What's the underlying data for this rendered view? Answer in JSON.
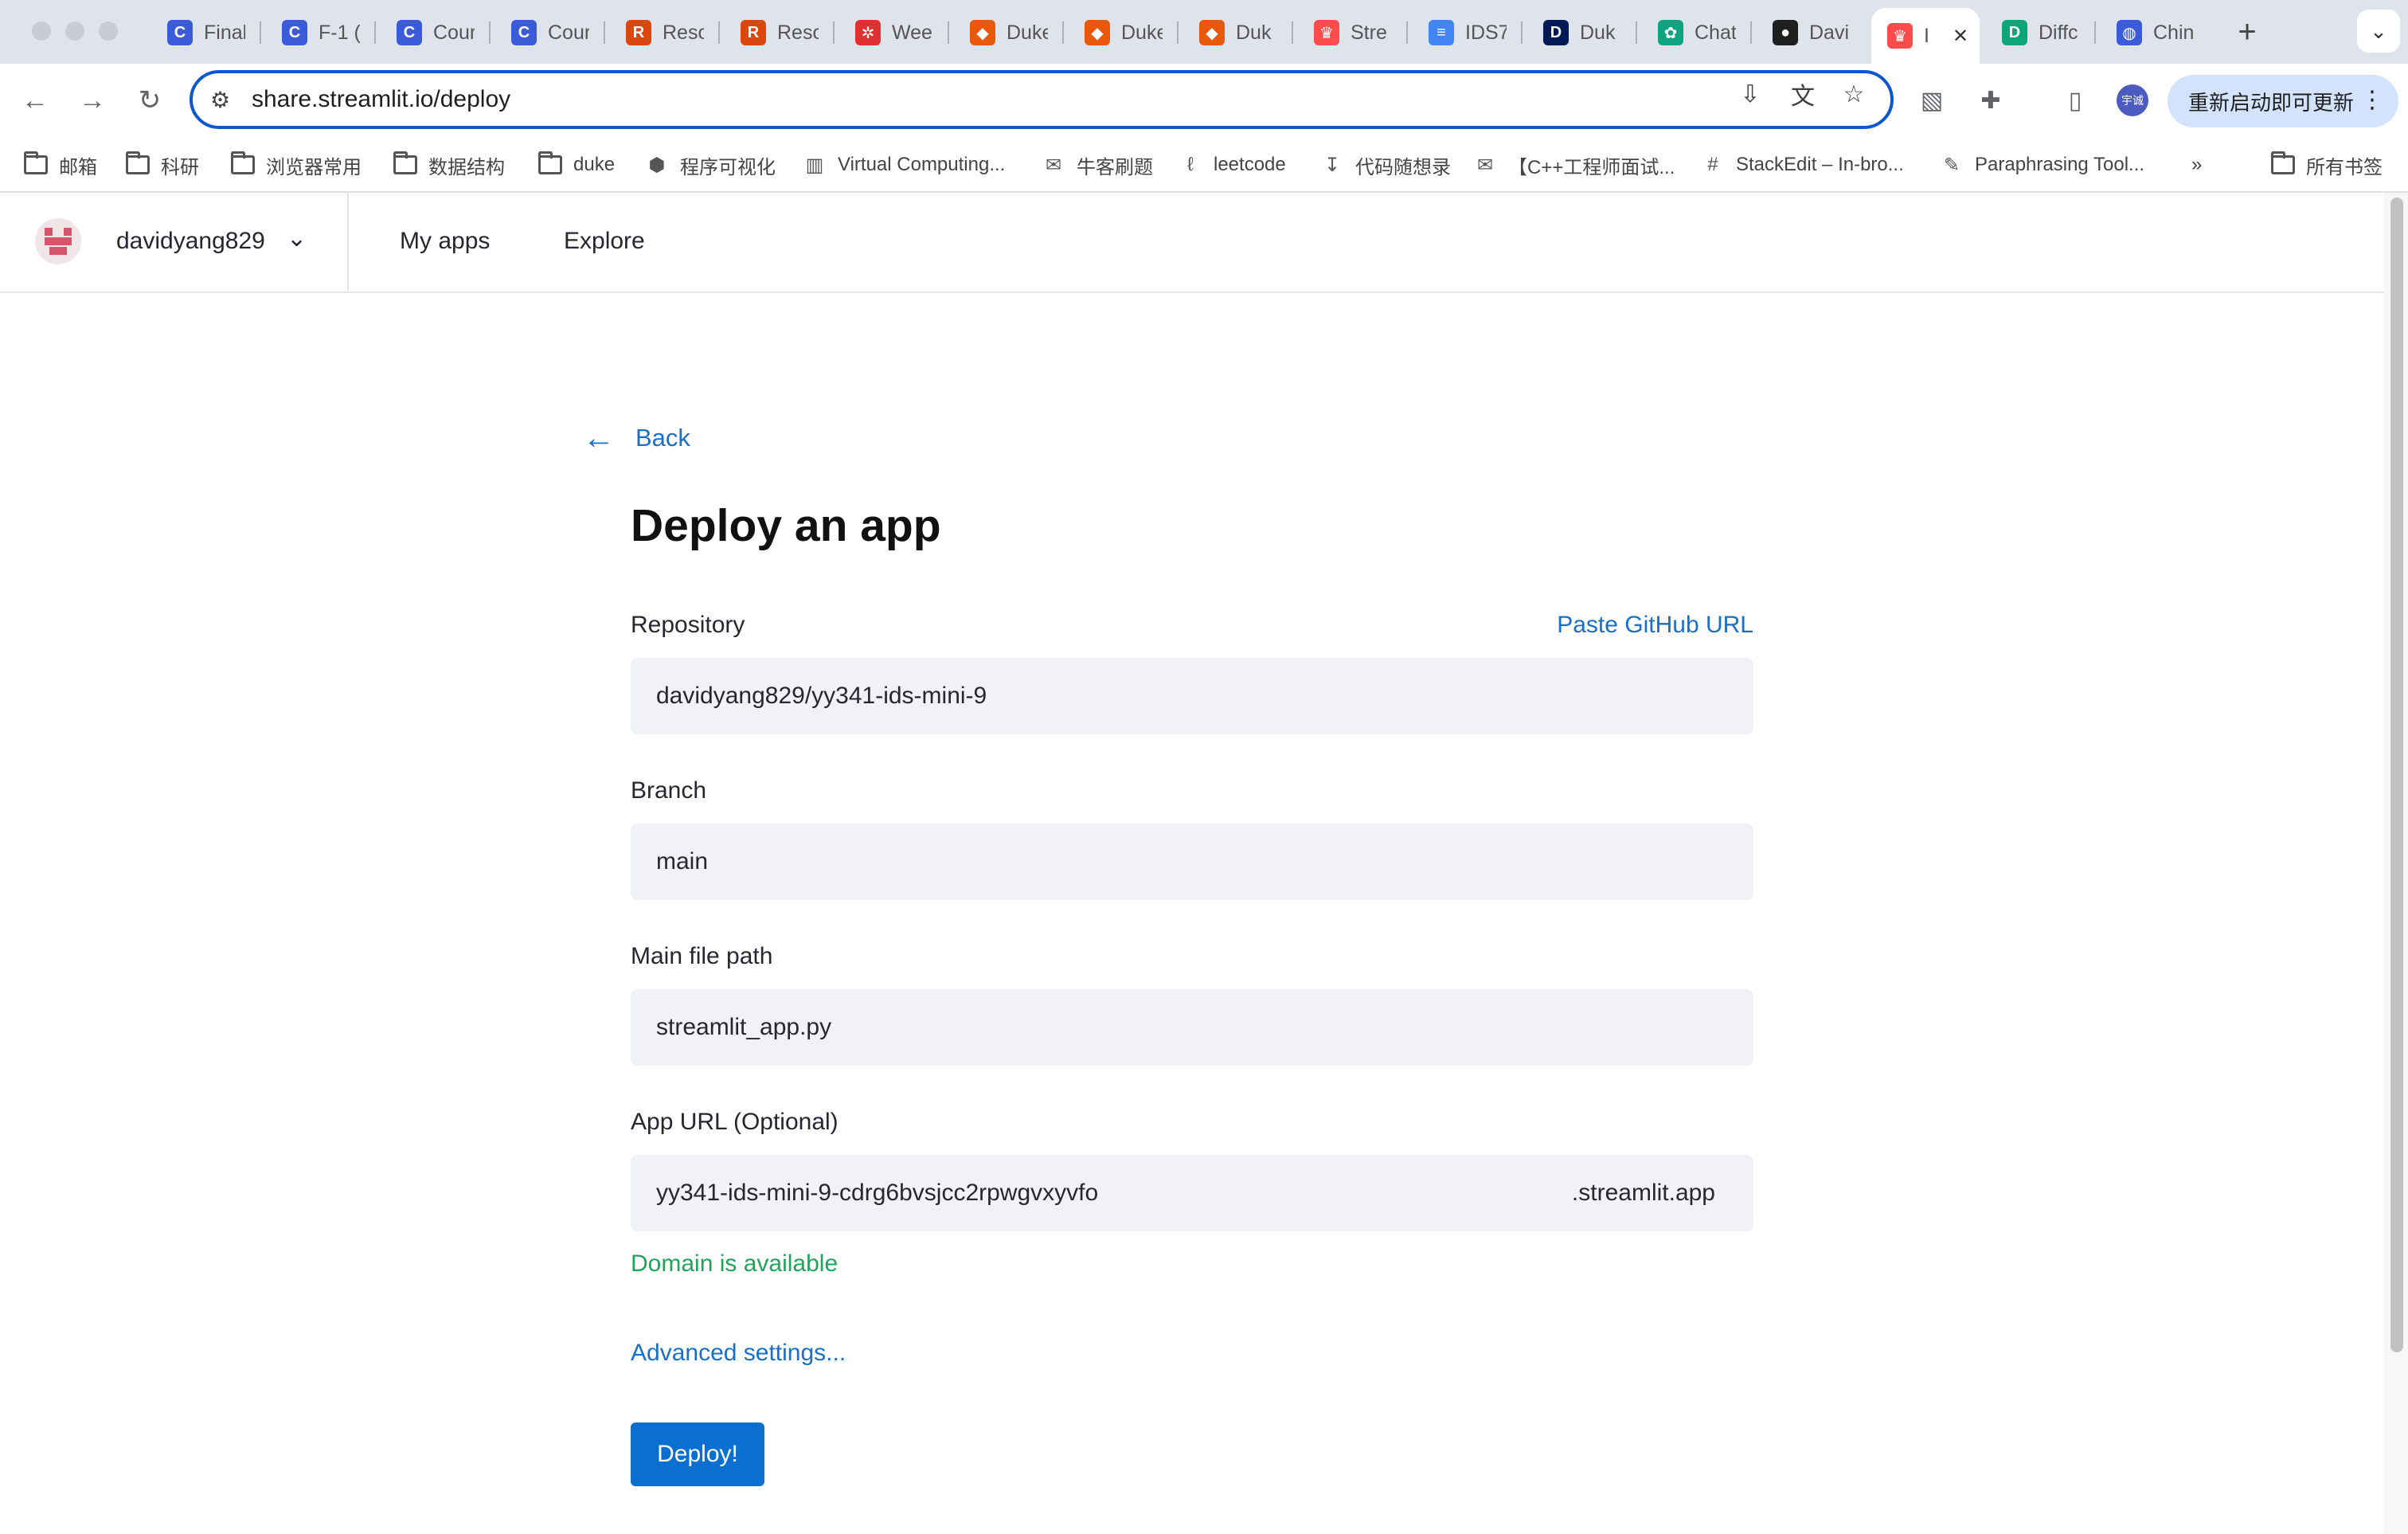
{
  "browser": {
    "tabs": [
      {
        "title": "Final",
        "icon": "coursera-icon",
        "color": "#3b5bdb"
      },
      {
        "title": "F-1 (",
        "icon": "coursera-icon",
        "color": "#3b5bdb"
      },
      {
        "title": "Cour",
        "icon": "coursera-icon",
        "color": "#3b5bdb"
      },
      {
        "title": "Cour",
        "icon": "coursera-icon",
        "color": "#3b5bdb"
      },
      {
        "title": "Reso",
        "icon": "research-icon",
        "color": "#d9480f"
      },
      {
        "title": "Reso",
        "icon": "research-icon",
        "color": "#d9480f"
      },
      {
        "title": "Wee",
        "icon": "wheel-icon",
        "color": "#e03131"
      },
      {
        "title": "Duke",
        "icon": "gitlab-icon",
        "color": "#e8590c"
      },
      {
        "title": "Duke",
        "icon": "gitlab-icon",
        "color": "#e8590c"
      },
      {
        "title": "Duk",
        "icon": "gitlab-icon",
        "color": "#e8590c"
      },
      {
        "title": "Stre",
        "icon": "streamlit-icon",
        "color": "#ff4b4b"
      },
      {
        "title": "IDS7",
        "icon": "docs-icon",
        "color": "#4285f4"
      },
      {
        "title": "Duk",
        "icon": "duke-icon",
        "color": "#001a57"
      },
      {
        "title": "Chat",
        "icon": "chatgpt-icon",
        "color": "#10a37f"
      },
      {
        "title": "Davi",
        "icon": "github-icon",
        "color": "#1f1f1f"
      },
      {
        "title": "I",
        "icon": "streamlit-icon",
        "color": "#ff4b4b"
      },
      {
        "title": "Diffc",
        "icon": "diff-icon",
        "color": "#0ca678"
      },
      {
        "title": "Chin",
        "icon": "globe-icon",
        "color": "#3b5bdb"
      }
    ],
    "url": "share.streamlit.io/deploy",
    "profile_label": "宇诚",
    "update_label": "重新启动即可更新",
    "bookmarks": [
      {
        "label": "邮箱",
        "icon": "folder-icon"
      },
      {
        "label": "科研",
        "icon": "folder-icon"
      },
      {
        "label": "浏览器常用",
        "icon": "folder-icon"
      },
      {
        "label": "数据结构",
        "icon": "folder-icon"
      },
      {
        "label": "duke",
        "icon": "folder-icon"
      },
      {
        "label": "程序可视化",
        "icon": "python-icon"
      },
      {
        "label": "Virtual Computing...",
        "icon": "vcm-icon"
      },
      {
        "label": "牛客刷题",
        "icon": "nowcoder-icon"
      },
      {
        "label": "leetcode",
        "icon": "leetcode-icon"
      },
      {
        "label": "代码随想录",
        "icon": "carl-icon"
      },
      {
        "label": "【C++工程师面试...",
        "icon": "nowcoder-icon"
      },
      {
        "label": "StackEdit – In-bro...",
        "icon": "stackedit-icon"
      },
      {
        "label": "Paraphrasing Tool...",
        "icon": "feather-icon"
      }
    ],
    "bookmarks_all": "所有书签"
  },
  "app": {
    "username": "davidyang829",
    "nav": {
      "my_apps": "My apps",
      "explore": "Explore"
    },
    "back_label": "Back",
    "title": "Deploy an app",
    "repository": {
      "label": "Repository",
      "paste_link": "Paste GitHub URL",
      "value": "davidyang829/yy341-ids-mini-9"
    },
    "branch": {
      "label": "Branch",
      "value": "main"
    },
    "main_file": {
      "label": "Main file path",
      "value": "streamlit_app.py"
    },
    "app_url": {
      "label": "App URL (Optional)",
      "value": "yy341-ids-mini-9-cdrg6bvsjcc2rpwgvxyvfo",
      "suffix": ".streamlit.app",
      "status": "Domain is available"
    },
    "advanced_label": "Advanced settings...",
    "deploy_label": "Deploy!"
  }
}
